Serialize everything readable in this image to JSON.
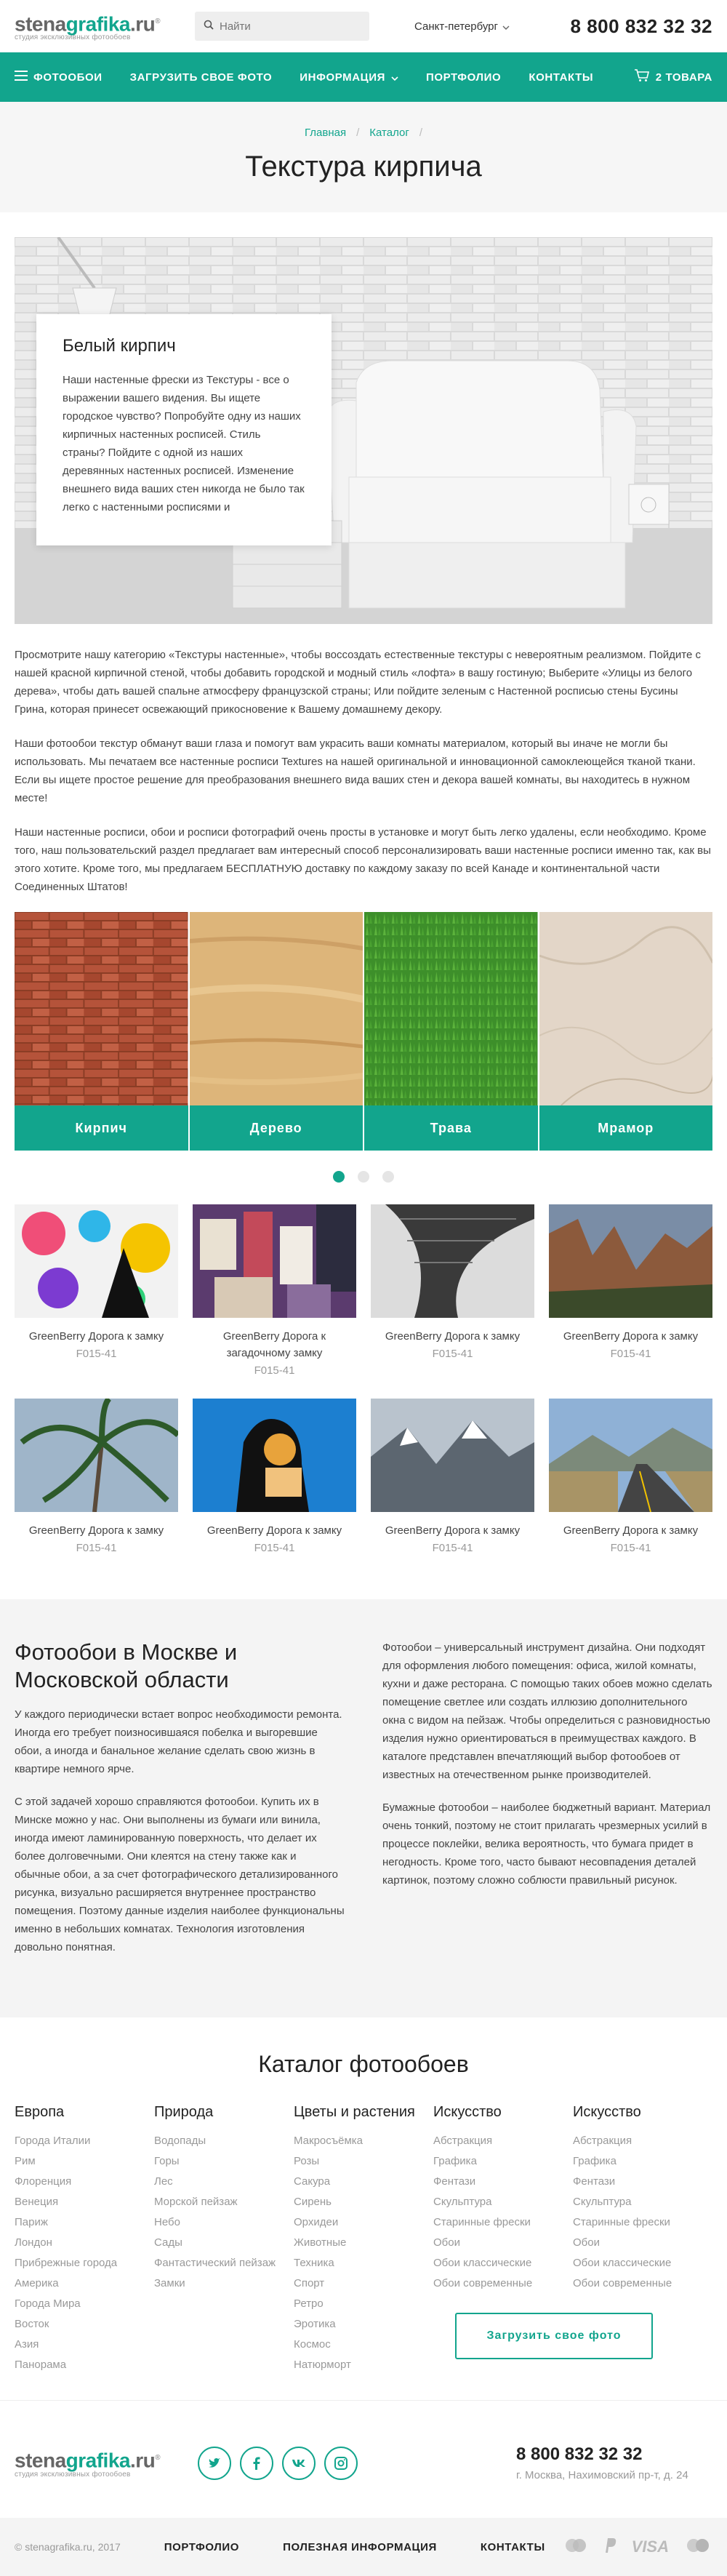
{
  "header": {
    "logo_a": "stena",
    "logo_b": "grafika",
    "logo_c": ".ru",
    "logo_registered": "®",
    "logo_sub": "студия эксклюзивных фотообоев",
    "search_placeholder": "Найти",
    "city": "Санкт-петербург",
    "phone": "8 800 832 32 32"
  },
  "nav": {
    "items": [
      {
        "label": "Фотообои"
      },
      {
        "label": "Загрузить свое фото"
      },
      {
        "label": "Информация"
      },
      {
        "label": "Портфолио"
      },
      {
        "label": "Контакты"
      }
    ],
    "cart_label": "2 товара"
  },
  "breadcrumbs": [
    "Главная",
    "Каталог"
  ],
  "page_title": "Текстура кирпича",
  "hero": {
    "title": "Белый кирпич",
    "text": "Наши настенные фрески из Текстуры - все о выражении вашего видения. Вы ищете городское чувство? Попробуйте одну из наших кирпичных настенных росписей. Стиль страны? Пойдите с одной из наших деревянных настенных росписей. Изменение внешнего вида ваших стен никогда не было так легко с настенными росписями и"
  },
  "intro": [
    "Просмотрите нашу категорию «Текстуры настенные», чтобы воссоздать естественные текстуры с невероятным реализмом. Пойдите с нашей красной кирпичной стеной, чтобы добавить городской и модный стиль «лофта» в вашу гостиную; Выберите «Улицы из белого дерева», чтобы дать вашей спальне атмосферу французской страны; Или пойдите зеленым с Настенной росписью стены Бусины Грина, которая принесет освежающий прикосновение к Вашему домашнему декору.",
    "Наши фотообои текстур обманут ваши глаза и помогут вам украсить ваши комнаты материалом, который вы иначе не могли бы использовать. Мы печатаем все настенные росписи Textures на нашей оригинальной и инновационной самоклеющейся тканой ткани. Если вы ищете простое решение для преобразования внешнего вида ваших стен и декора вашей комнаты, вы находитесь в нужном месте!",
    "Наши настенные росписи, обои и росписи фотографий очень просты в установке и могут быть легко удалены, если необходимо. Кроме того, наш пользовательский раздел предлагает вам интересный способ персонализировать ваши настенные росписи именно так, как вы этого хотите. Кроме того, мы предлагаем БЕСПЛАТНУЮ доставку по каждому заказу по всей Канаде и континентальной части Соединенных Штатов!"
  ],
  "categories": [
    {
      "label": "Кирпич"
    },
    {
      "label": "Дерево"
    },
    {
      "label": "Трава"
    },
    {
      "label": "Мрамор"
    }
  ],
  "products": [
    {
      "name": "GreenBerry Дорога к замку",
      "code": "F015-41"
    },
    {
      "name": "GreenBerry Дорога к загадочному замку",
      "code": "F015-41"
    },
    {
      "name": "GreenBerry Дорога к замку",
      "code": "F015-41"
    },
    {
      "name": "GreenBerry Дорога к замку",
      "code": "F015-41"
    },
    {
      "name": "GreenBerry Дорога к замку",
      "code": "F015-41"
    },
    {
      "name": "GreenBerry Дорога к замку",
      "code": "F015-41"
    },
    {
      "name": "GreenBerry Дорога к замку",
      "code": "F015-41"
    },
    {
      "name": "GreenBerry Дорога к замку",
      "code": "F015-41"
    }
  ],
  "seo": {
    "title": "Фотообои в Москве и Московской области",
    "left": [
      "У каждого периодически встает вопрос необходимости ремонта. Иногда его требует поизносившаяся побелка и выгоревшие обои, а иногда и банальное желание сделать свою жизнь в квартире немного ярче.",
      "С этой задачей хорошо справляются фотообои. Купить их в Минске можно у нас. Они выполнены из бумаги или винила, иногда имеют ламинированную поверхность, что делает их более долговечными. Они клеятся на стену также как и обычные обои, а за счет фотографического детализированного рисунка, визуально расширяется внутреннее пространство помещения. Поэтому данные изделия наиболее функциональны именно в небольших комнатах. Технология изготовления довольно понятная."
    ],
    "right": [
      "Фотообои – универсальный инструмент дизайна. Они подходят для оформления любого помещения: офиса, жилой комнаты, кухни и даже ресторана. С помощью таких обоев можно сделать помещение светлее или создать иллюзию дополнительного окна с видом на пейзаж. Чтобы определиться с разновидностью изделия нужно ориентироваться в преимуществах каждого. В каталоге представлен впечатляющий выбор фотообоев от известных на отечественном рынке производителей.",
      "Бумажные фотообои – наиболее бюджетный вариант. Материал очень тонкий, поэтому не стоит прилагать чрезмерных усилий в процессе поклейки, велика вероятность, что бумага придет в негодность. Кроме того, часто бывают несовпадения деталей картинок, поэтому сложно соблюсти правильный рисунок."
    ]
  },
  "catalog": {
    "title": "Каталог фотообоев",
    "columns": [
      {
        "title": "Европа",
        "items": [
          "Города Италии",
          "Рим",
          "Флоренция",
          "Венеция",
          "Париж",
          "Лондон",
          "Прибрежные города",
          "Америка",
          "Города Мира",
          "Восток",
          "Азия",
          "Панорама"
        ]
      },
      {
        "title": "Природа",
        "items": [
          "Водопады",
          "Горы",
          "Лес",
          "Морской пейзаж",
          "Небо",
          "Сады",
          "Фантастический пейзаж",
          "Замки"
        ]
      },
      {
        "title": "Цветы и растения",
        "items": [
          "Макросъёмка",
          "Розы",
          "Сакура",
          "Сирень",
          "Орхидеи",
          "Животные",
          "Техника",
          "Спорт",
          "Ретро",
          "Эротика",
          "Космос",
          "Натюрморт"
        ]
      },
      {
        "title": "Искусство",
        "items": [
          "Абстракция",
          "Графика",
          "Фентази",
          "Скульптура",
          "Старинные фрески",
          "Обои",
          "Обои классические",
          "Обои современные"
        ]
      },
      {
        "title": "Искусство",
        "items": [
          "Абстракция",
          "Графика",
          "Фентази",
          "Скульптура",
          "Старинные фрески",
          "Обои",
          "Обои классические",
          "Обои современные"
        ]
      }
    ],
    "cta": "Загрузить свое фото"
  },
  "footer": {
    "phone": "8 800 832 32 32",
    "address": "г. Москва, Нахимовский пр-т, д. 24",
    "social": [
      "t",
      "f",
      "vk",
      "ig"
    ],
    "copyright": "© stenagrafika.ru, 2017",
    "links": [
      "Портфолио",
      "Полезная информация",
      "Контакты"
    ],
    "payments": [
      "VISA"
    ]
  },
  "colors": {
    "accent": "#12a58d",
    "band": "#f4f4f4"
  }
}
